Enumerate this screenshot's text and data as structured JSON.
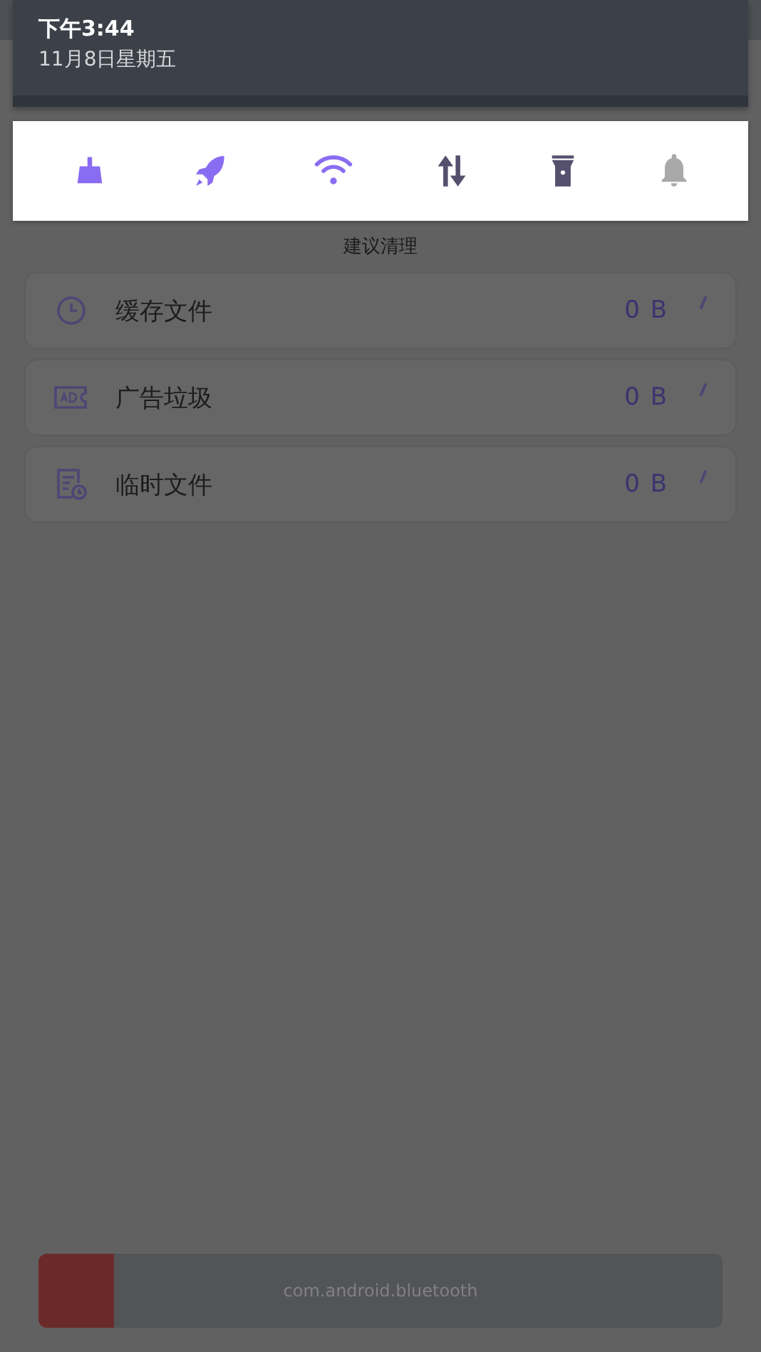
{
  "status_panel": {
    "time": "下午3:44",
    "date": "11月8日星期五"
  },
  "quick_tiles": [
    {
      "kind": "broom",
      "on": true
    },
    {
      "kind": "rocket",
      "on": true
    },
    {
      "kind": "wifi",
      "on": true
    },
    {
      "kind": "data",
      "on": false
    },
    {
      "kind": "flashlight",
      "on": false
    },
    {
      "kind": "bell",
      "on": false
    }
  ],
  "section_title": "建议清理",
  "items": [
    {
      "kind": "clock",
      "label": "缓存文件",
      "size": "0 B"
    },
    {
      "kind": "ad",
      "label": "广告垃圾",
      "size": "0 B"
    },
    {
      "kind": "temp",
      "label": "临时文件",
      "size": "0 B"
    }
  ],
  "progress": {
    "label": "com.android.bluetooth",
    "level": 0.11
  }
}
